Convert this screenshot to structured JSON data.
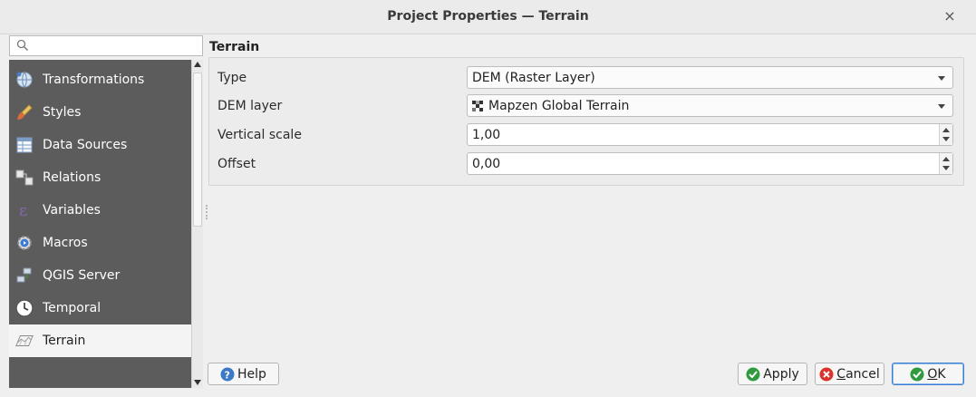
{
  "window": {
    "title": "Project Properties — Terrain",
    "close_symbol": "×"
  },
  "search": {
    "placeholder": "",
    "icon": "search-icon"
  },
  "sidebar": {
    "items": [
      {
        "label": "Transformations",
        "icon": "globe-transform-icon"
      },
      {
        "label": "Styles",
        "icon": "paintbrush-icon"
      },
      {
        "label": "Data Sources",
        "icon": "table-icon"
      },
      {
        "label": "Relations",
        "icon": "relations-icon"
      },
      {
        "label": "Variables",
        "icon": "epsilon-icon"
      },
      {
        "label": "Macros",
        "icon": "gear-play-icon"
      },
      {
        "label": "QGIS Server",
        "icon": "server-icon"
      },
      {
        "label": "Temporal",
        "icon": "clock-icon"
      },
      {
        "label": "Terrain",
        "icon": "terrain-icon",
        "active": true
      }
    ]
  },
  "main": {
    "section_title": "Terrain",
    "rows": {
      "type": {
        "label": "Type",
        "value": "DEM (Raster Layer)"
      },
      "dem_layer": {
        "label": "DEM layer",
        "value": "Mapzen Global Terrain"
      },
      "vertical_scale": {
        "label": "Vertical scale",
        "value": "1,00"
      },
      "offset": {
        "label": "Offset",
        "value": "0,00"
      }
    }
  },
  "buttons": {
    "help": "Help",
    "apply": "Apply",
    "cancel_prefix": "",
    "cancel_underlined": "C",
    "cancel_rest": "ancel",
    "ok_underlined": "O",
    "ok_rest": "K"
  },
  "colors": {
    "sidebar_bg": "#5c5c5c",
    "active_item_bg": "#f4f4f4",
    "ok_border": "#3d7fd0",
    "apply_green": "#2f9a3e",
    "cancel_red": "#d9342b",
    "help_blue": "#3b78c6"
  }
}
